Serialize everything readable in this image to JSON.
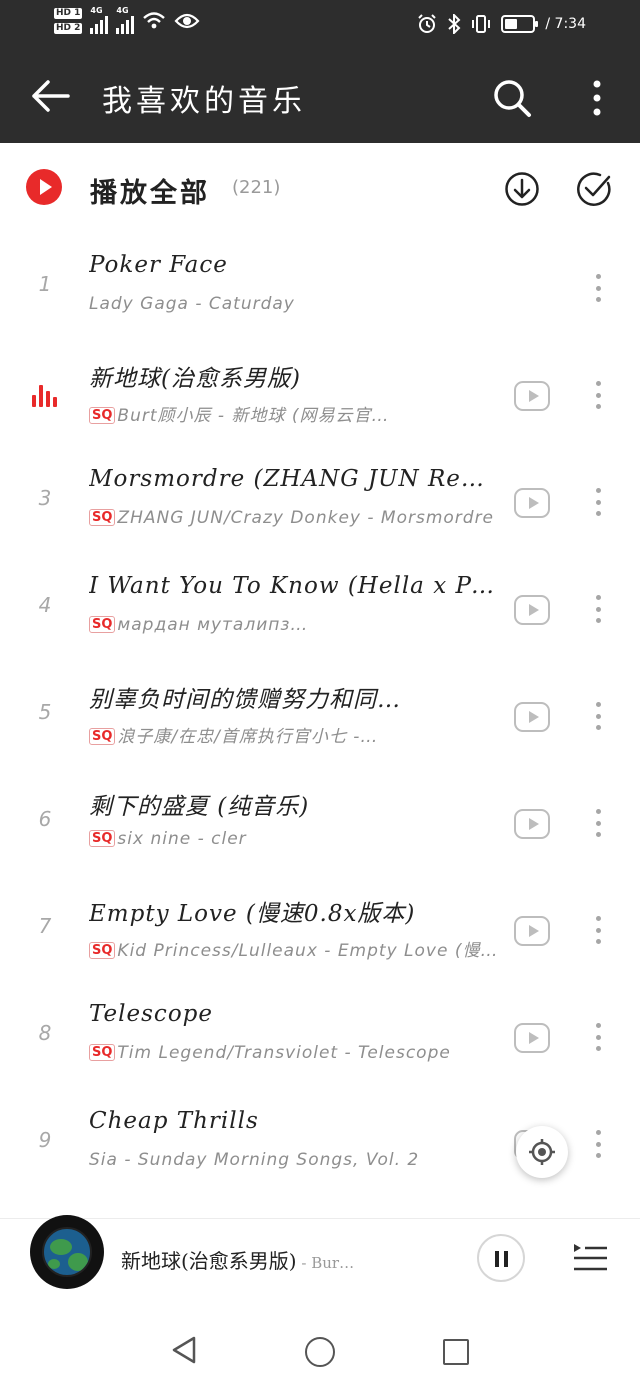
{
  "status_bar": {
    "hd1": "HD 1",
    "hd2": "HD 2",
    "net1": "4G",
    "net2": "4G",
    "time": "7:34"
  },
  "header": {
    "title": "我喜欢的音乐",
    "back_icon": "arrow-left-icon",
    "search_icon": "search-icon",
    "more_icon": "more-vertical-icon"
  },
  "play_all": {
    "label": "播放全部",
    "count": "(221)"
  },
  "songs": [
    {
      "index": "1",
      "title": "Poker Face",
      "sq": "",
      "subtitle": "Lady Gaga - Caturday"
    },
    {
      "index": "",
      "title": "新地球(治愈系男版)",
      "sq": "SQ",
      "subtitle": "Burt顾小辰 - 新地球 (网易云官…"
    },
    {
      "index": "3",
      "title": "Morsmordre (ZHANG JUN Remix)",
      "sq": "SQ",
      "subtitle": "ZHANG JUN/Crazy Donkey - Morsmordre"
    },
    {
      "index": "4",
      "title": "I Want You To Know (Hella x Pe…",
      "sq": "SQ",
      "subtitle": "мардан муталипз…"
    },
    {
      "index": "5",
      "title": "别辜负时间的馈赠努力和同…",
      "sq": "SQ",
      "subtitle": "浪子康/在忠/首席执行官小七 -…"
    },
    {
      "index": "6",
      "title": "剩下的盛夏 (纯音乐)",
      "sq": "SQ",
      "subtitle": "six nine - cler"
    },
    {
      "index": "7",
      "title": "Empty Love (慢速0.8x版本)",
      "sq": "SQ",
      "subtitle": "Kid Princess/Lulleaux - Empty Love (慢…"
    },
    {
      "index": "8",
      "title": "Telescope",
      "sq": "SQ",
      "subtitle": "Tim Legend/Transviolet - Telescope"
    },
    {
      "index": "9",
      "title": "Cheap Thrills",
      "sq": "",
      "subtitle": "Sia - Sunday Morning Songs, Vol. 2"
    }
  ],
  "now_playing": {
    "title": "新地球(治愈系男版)",
    "artist": " - Bur…"
  },
  "colors": {
    "accent": "#e82a2a",
    "header_bg": "#2d2d2d",
    "secondary_text": "#8e8e8e"
  }
}
